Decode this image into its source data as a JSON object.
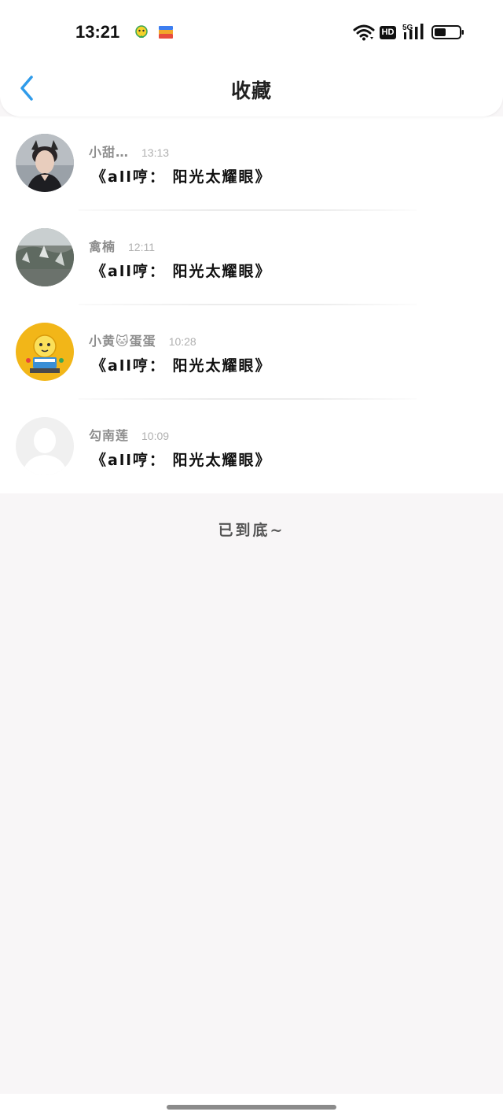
{
  "status_bar": {
    "time": "13:21",
    "hd_label": "HD",
    "network_label": "5G",
    "icons": [
      "app-notification-icon",
      "wallet-app-icon",
      "wifi-icon",
      "signal-icon",
      "battery-icon"
    ]
  },
  "header": {
    "title": "收藏",
    "back_icon": "chevron-left-icon",
    "accent_color": "#2f9bea"
  },
  "items": [
    {
      "name": "小甜…",
      "time": "13:13",
      "content": "《all哼：  阳光太耀眼》",
      "avatar": "portrait-photo"
    },
    {
      "name": "禽楠",
      "time": "12:11",
      "content": "《all哼：  阳光太耀眼》",
      "avatar": "landscape-photo"
    },
    {
      "name": "小黄🐱蛋蛋",
      "time": "10:28",
      "content": "《all哼：  阳光太耀眼》",
      "avatar": "yellow-cartoon"
    },
    {
      "name": "勾南莲",
      "time": "10:09",
      "content": "《all哼：  阳光太耀眼》",
      "avatar": "default-silhouette"
    }
  ],
  "footer": {
    "end_text": "已到底~"
  }
}
